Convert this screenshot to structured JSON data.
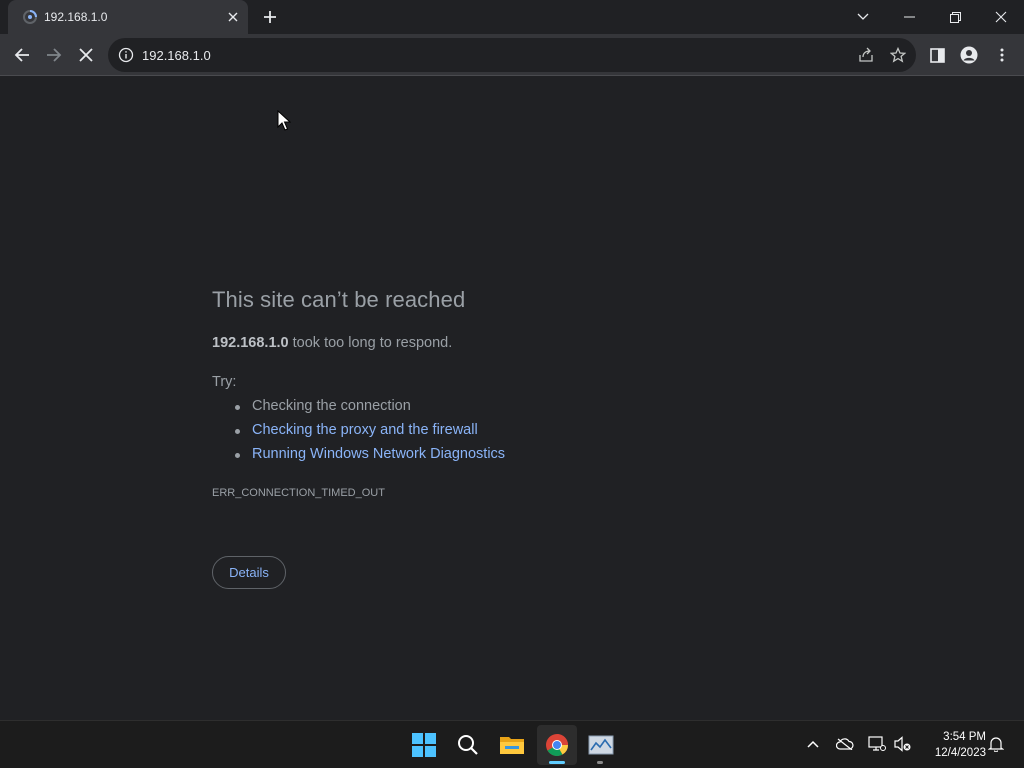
{
  "browser": {
    "tab": {
      "title": "192.168.1.0",
      "favicon": "loading-spinner-icon"
    },
    "address_bar": {
      "url": "192.168.1.0",
      "info_icon": "info-icon"
    },
    "toolbar_icons": [
      "back-arrow-icon",
      "forward-arrow-icon",
      "stop-icon",
      "share-icon",
      "star-icon",
      "side-panel-icon",
      "profile-icon",
      "more-vert-icon"
    ],
    "window_controls": [
      "tab-search-chevron-icon",
      "minimize-icon",
      "restore-icon",
      "close-icon"
    ]
  },
  "error_page": {
    "title": "This site can’t be reached",
    "host": "192.168.1.0",
    "message": " took too long to respond.",
    "try_label": "Try:",
    "suggestions": [
      {
        "text": "Checking the connection",
        "link": false
      },
      {
        "text": "Checking the proxy and the firewall",
        "link": true
      },
      {
        "text": "Running Windows Network Diagnostics",
        "link": true
      }
    ],
    "error_code": "ERR_CONNECTION_TIMED_OUT",
    "details_button": "Details"
  },
  "taskbar": {
    "apps": [
      "windows-start-icon",
      "search-icon",
      "file-explorer-icon",
      "chrome-icon",
      "network-monitor-icon"
    ],
    "tray": [
      "show-hidden-icons-chevron",
      "onedrive-offline-icon",
      "network-icon",
      "volume-muted-icon",
      "notifications-bell-icon"
    ],
    "time": "3:54 PM",
    "date": "12/4/2023"
  },
  "colors": {
    "page_bg": "#202124",
    "toolbar_bg": "#35363a",
    "text_muted": "#9aa0a6",
    "link": "#8ab4f8",
    "taskbar_bg": "#1c1c1c",
    "accent": "#60cdff"
  }
}
